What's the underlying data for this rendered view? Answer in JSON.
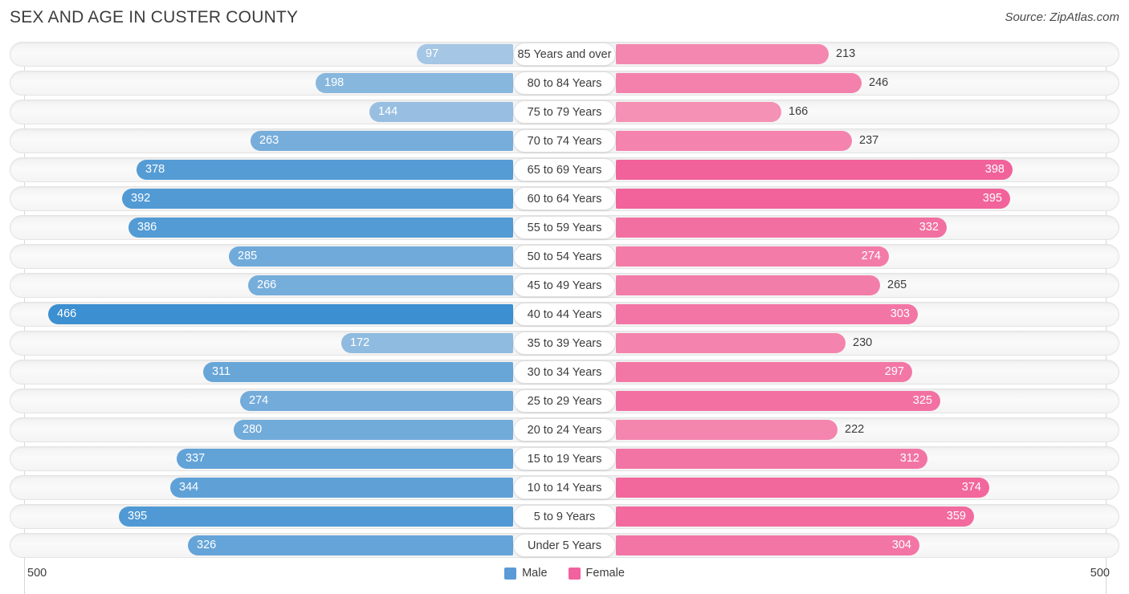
{
  "header": {
    "title": "SEX AND AGE IN CUSTER COUNTY",
    "source": "Source: ZipAtlas.com"
  },
  "legend": {
    "male_label": "Male",
    "female_label": "Female",
    "male_color": "#5b9bd5",
    "female_color": "#f2629f"
  },
  "axis": {
    "left_max_label": "500",
    "right_max_label": "500",
    "max": 500
  },
  "chart_data": {
    "type": "bar",
    "subtype": "population-pyramid",
    "title": "SEX AND AGE IN CUSTER COUNTY",
    "xlabel": "",
    "ylabel": "",
    "xlim": [
      500,
      500
    ],
    "grid": true,
    "legend_position": "bottom-center",
    "categories": [
      "85 Years and over",
      "80 to 84 Years",
      "75 to 79 Years",
      "70 to 74 Years",
      "65 to 69 Years",
      "60 to 64 Years",
      "55 to 59 Years",
      "50 to 54 Years",
      "45 to 49 Years",
      "40 to 44 Years",
      "35 to 39 Years",
      "30 to 34 Years",
      "25 to 29 Years",
      "20 to 24 Years",
      "15 to 19 Years",
      "10 to 14 Years",
      "5 to 9 Years",
      "Under 5 Years"
    ],
    "series": [
      {
        "name": "Male",
        "color": "#5b9bd5",
        "values": [
          97,
          198,
          144,
          263,
          378,
          392,
          386,
          285,
          266,
          466,
          172,
          311,
          274,
          280,
          337,
          344,
          395,
          326
        ]
      },
      {
        "name": "Female",
        "color": "#f2629f",
        "values": [
          213,
          246,
          166,
          237,
          398,
          395,
          332,
          274,
          265,
          303,
          230,
          297,
          325,
          222,
          312,
          374,
          359,
          304
        ]
      }
    ]
  }
}
